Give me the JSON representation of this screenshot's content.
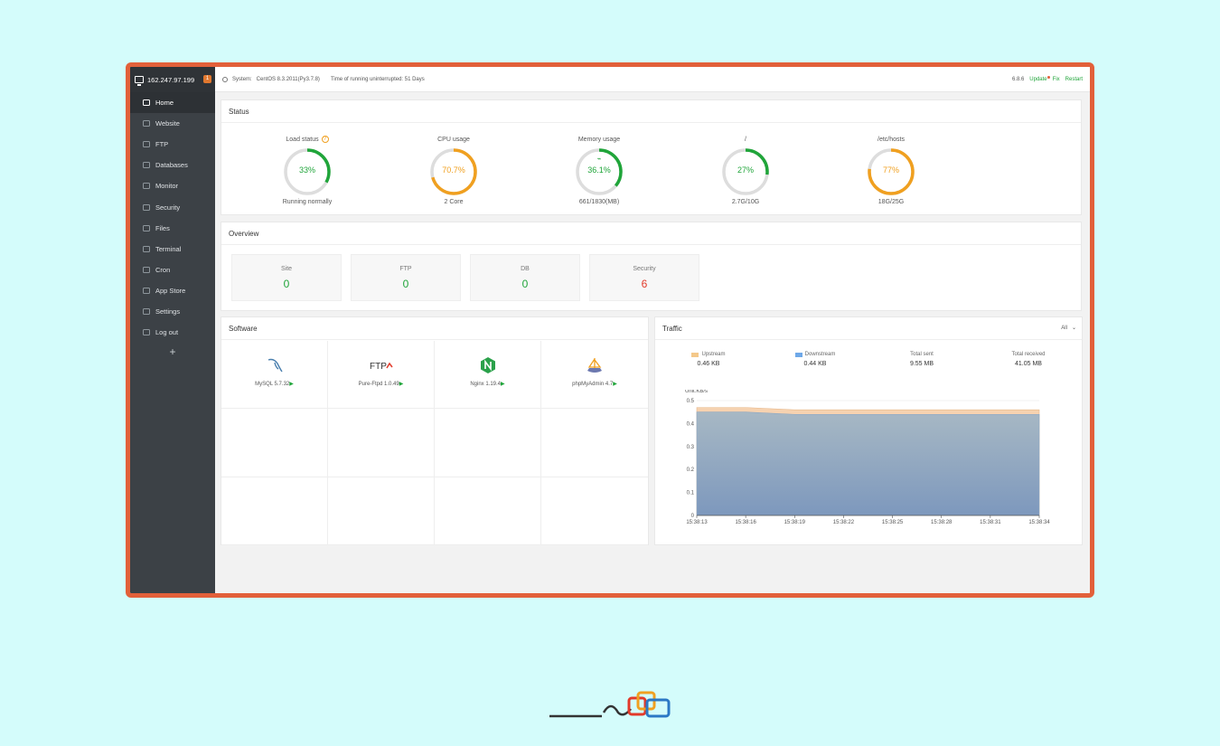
{
  "sidebar": {
    "server_ip": "162.247.97.199",
    "badge": "1",
    "items": [
      {
        "label": "Home",
        "icon": "home-icon"
      },
      {
        "label": "Website",
        "icon": "globe-icon"
      },
      {
        "label": "FTP",
        "icon": "ftp-icon"
      },
      {
        "label": "Databases",
        "icon": "database-icon"
      },
      {
        "label": "Monitor",
        "icon": "monitor-icon"
      },
      {
        "label": "Security",
        "icon": "shield-icon"
      },
      {
        "label": "Files",
        "icon": "folder-icon"
      },
      {
        "label": "Terminal",
        "icon": "terminal-icon"
      },
      {
        "label": "Cron",
        "icon": "calendar-icon"
      },
      {
        "label": "App Store",
        "icon": "grid-icon"
      },
      {
        "label": "Settings",
        "icon": "gear-icon"
      },
      {
        "label": "Log out",
        "icon": "logout-icon"
      }
    ],
    "add_label": "+"
  },
  "topbar": {
    "system_label": "System:",
    "system_value": "CentOS 8.3.2011(Py3.7.8)",
    "uptime": "Time of running uninterrupted: 51 Days",
    "version": "6.8.6",
    "update_label": "Update",
    "fix_label": "Fix",
    "restart_label": "Restart"
  },
  "status": {
    "title": "Status",
    "gauges": [
      {
        "label": "Load status",
        "value": "33%",
        "percent": 33,
        "sub": "Running normally",
        "color": "#20a53a"
      },
      {
        "label": "CPU usage",
        "value": "70.7%",
        "percent": 70.7,
        "sub": "2 Core",
        "color": "#f0a020"
      },
      {
        "label": "Memory usage",
        "value": "36.1%",
        "percent": 36.1,
        "sub": "661/1830(MB)",
        "color": "#20a53a"
      },
      {
        "label": "/",
        "value": "27%",
        "percent": 27,
        "sub": "2.7G/10G",
        "color": "#20a53a"
      },
      {
        "label": "/etc/hosts",
        "value": "77%",
        "percent": 77,
        "sub": "18G/25G",
        "color": "#f0a020"
      }
    ]
  },
  "overview": {
    "title": "Overview",
    "cards": [
      {
        "label": "Site",
        "value": "0"
      },
      {
        "label": "FTP",
        "value": "0"
      },
      {
        "label": "DB",
        "value": "0"
      },
      {
        "label": "Security",
        "value": "6"
      }
    ]
  },
  "software": {
    "title": "Software",
    "items": [
      {
        "name": "MySQL 5.7.32",
        "icon": "mysql-dolphin-icon"
      },
      {
        "name": "Pure-Ftpd 1.0.49",
        "icon": "ftp-logo-icon"
      },
      {
        "name": "Nginx 1.19.4",
        "icon": "nginx-icon"
      },
      {
        "name": "phpMyAdmin 4.7",
        "icon": "phpmyadmin-icon"
      }
    ]
  },
  "traffic": {
    "title": "Traffic",
    "select_value": "All",
    "stats": [
      {
        "label": "Upstream",
        "value": "0.46 KB",
        "color": "#f4c88a"
      },
      {
        "label": "Downstream",
        "value": "0.44 KB",
        "color": "#6ea8e8"
      },
      {
        "label": "Total sent",
        "value": "9.55 MB"
      },
      {
        "label": "Total received",
        "value": "41.05 MB"
      }
    ]
  },
  "chart_data": {
    "type": "area",
    "ylabel": "Unit:KB/s",
    "ylim": [
      0,
      0.5
    ],
    "yticks": [
      "0",
      "0.1",
      "0.2",
      "0.3",
      "0.4",
      "0.5"
    ],
    "categories": [
      "15:38:13",
      "15:38:16",
      "15:38:19",
      "15:38:22",
      "15:38:25",
      "15:38:28",
      "15:38:31",
      "15:38:34"
    ],
    "series": [
      {
        "name": "Downstream",
        "values": [
          0.45,
          0.45,
          0.44,
          0.44,
          0.44,
          0.44,
          0.44,
          0.44
        ],
        "color": "#7f9fc2"
      },
      {
        "name": "Upstream",
        "values": [
          0.47,
          0.47,
          0.46,
          0.46,
          0.46,
          0.46,
          0.46,
          0.46
        ],
        "color": "#f6d2b0"
      }
    ]
  }
}
